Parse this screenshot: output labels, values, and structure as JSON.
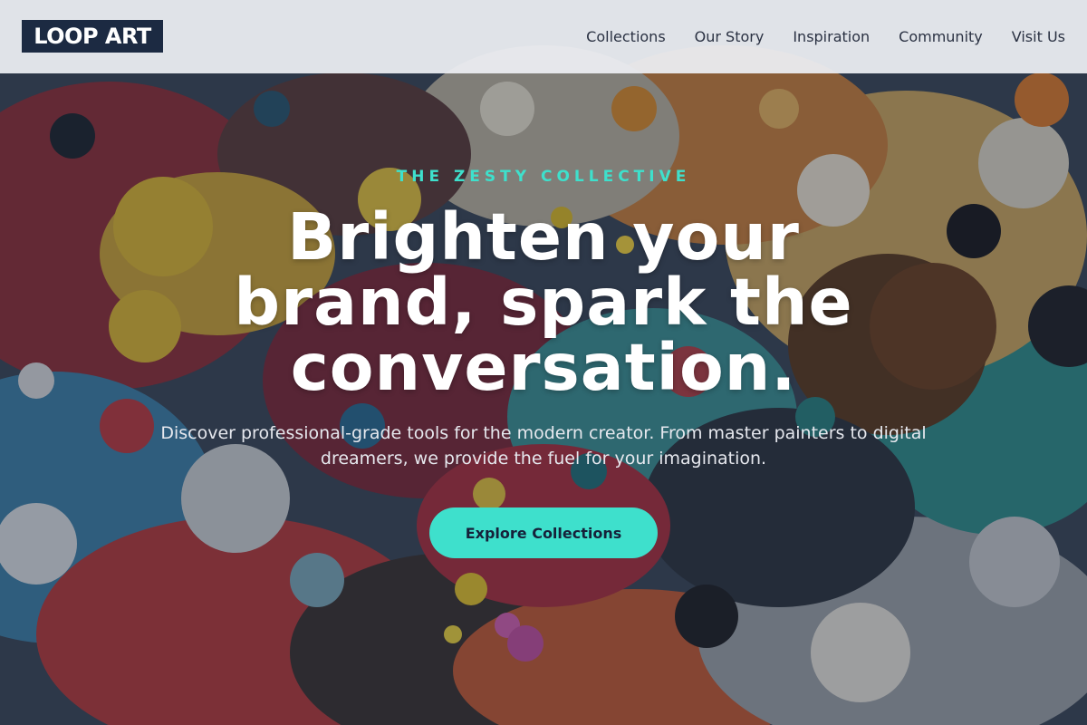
{
  "brand": {
    "logo_text": "LOOP ART"
  },
  "nav": {
    "items": [
      {
        "label": "Collections"
      },
      {
        "label": "Our Story"
      },
      {
        "label": "Inspiration"
      },
      {
        "label": "Community"
      },
      {
        "label": "Visit Us"
      }
    ]
  },
  "hero": {
    "eyebrow": "THE ZESTY COLLECTIVE",
    "headline": "Brighten your brand, spark the conversation.",
    "subtitle": "Discover professional-grade tools for the modern creator. From master painters to digital dreamers, we provide the fuel for your imagination.",
    "cta_label": "Explore Collections"
  },
  "colors": {
    "accent": "#3ee0cc",
    "logo_bg": "#1c2a42",
    "nav_bg": "#eceef2",
    "headline": "#ffffff"
  }
}
